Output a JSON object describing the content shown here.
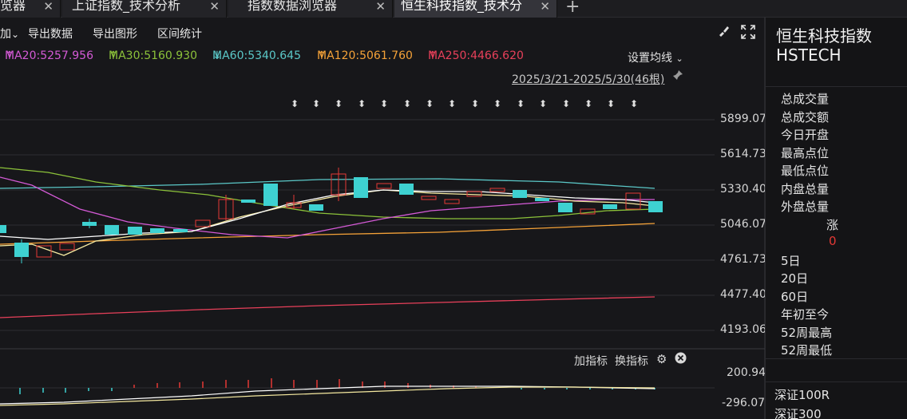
{
  "tabs": [
    {
      "label": "览器",
      "close": "✕"
    },
    {
      "label": "上证指数_技术分析",
      "close": "✕"
    },
    {
      "label": "指数数据浏览器",
      "close": "✕"
    },
    {
      "label": "恒生科技指数_技术分",
      "close": "✕"
    }
  ],
  "tab_add": "+",
  "toolbar": {
    "items": [
      "加",
      "导出数据",
      "导出图形",
      "区间统计"
    ],
    "dropdown_chevron": "⌄"
  },
  "ma": {
    "ma20": "MA20:5257.956",
    "ma30": "MA30:5160.930",
    "ma60": "MA60:5340.645",
    "ma120": "MA120:5061.760",
    "ma250": "MA250:4466.620",
    "arrow_up": "↑",
    "arrow_down": "↓",
    "set_label": "设置均线",
    "colors": {
      "ma20": "#d45ad6",
      "ma30": "#8cc23a",
      "ma60": "#5bc8c8",
      "ma120": "#f5a238",
      "ma250": "#e8405a"
    }
  },
  "date_range": "2025/3/21-2025/5/30(46根)",
  "price_axis": [
    "5899.07",
    "5614.73",
    "5330.40",
    "5046.07",
    "4761.73",
    "4477.40",
    "4193.06"
  ],
  "indicator": {
    "add_label": "加指标",
    "switch_label": "换指标",
    "scale_top": "200.94",
    "scale_bottom": "-296.07"
  },
  "right_panel": {
    "name": "恒生科技指数",
    "code": "HSTECH",
    "fields": [
      "总成交量",
      "总成交额",
      "今日开盘",
      "最高点位",
      "最低点位",
      "内盘总量",
      "外盘总量"
    ],
    "change_label": "涨",
    "change_value": "0",
    "periods": [
      "5日",
      "20日",
      "60日",
      "年初至今",
      "52周最高",
      "52周最低"
    ],
    "related": [
      "深证100R",
      "深证300"
    ]
  },
  "colors": {
    "up": "#e53935",
    "down": "#3ed1d1",
    "background": "#17171a"
  }
}
